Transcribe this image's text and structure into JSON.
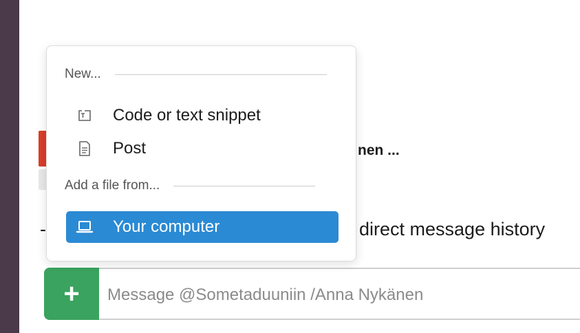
{
  "background": {
    "partial_name_text": "nen ...",
    "history_text": "direct message history",
    "dash_text": "-"
  },
  "popup": {
    "new_header": "New...",
    "new_items": [
      {
        "label": "Code or text snippet",
        "icon": "snippet-icon"
      },
      {
        "label": "Post",
        "icon": "post-document-icon"
      }
    ],
    "add_file_header": "Add a file from...",
    "file_items": [
      {
        "label": "Your computer",
        "icon": "laptop-icon",
        "selected": true
      }
    ]
  },
  "composer": {
    "plus_label": "+",
    "placeholder": "Message @Sometaduuniin /Anna Nykänen",
    "value": ""
  },
  "colors": {
    "sidebar": "#4a3a4a",
    "selected_item": "#2b8ad4",
    "plus_button": "#3aa35f",
    "red_marker": "#d93d2b"
  }
}
